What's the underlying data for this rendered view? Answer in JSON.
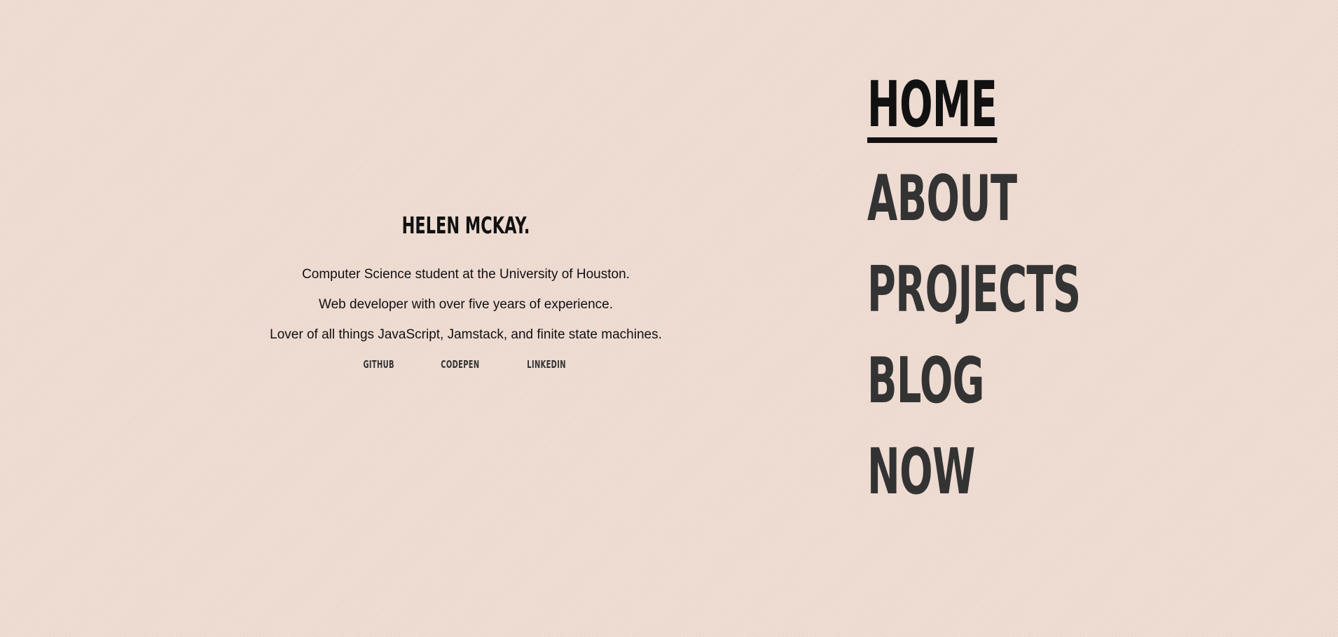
{
  "intro": {
    "name": "Helen McKay.",
    "lines": [
      "Computer Science student at the University of Houston.",
      "Web developer with over five years of experience.",
      "Lover of all things JavaScript, Jamstack, and finite state machines."
    ],
    "social": [
      {
        "label": "Github"
      },
      {
        "label": "Codepen"
      },
      {
        "label": "LinkedIn"
      }
    ]
  },
  "nav": {
    "active": "Home",
    "items": [
      {
        "label": "Home"
      },
      {
        "label": "About"
      },
      {
        "label": "Projects"
      },
      {
        "label": "Blog"
      },
      {
        "label": "Now"
      }
    ]
  },
  "colors": {
    "background": "#eedbd1",
    "text": "#111111",
    "nav_text": "#333333"
  }
}
